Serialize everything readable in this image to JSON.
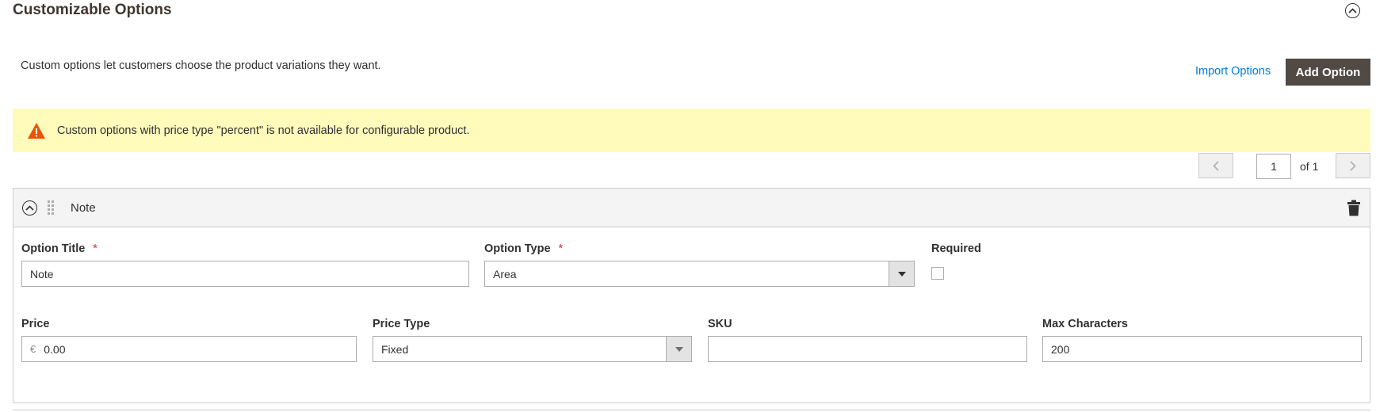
{
  "section": {
    "title": "Customizable Options",
    "intro": "Custom options let customers choose the product variations they want.",
    "import_label": "Import Options",
    "add_label": "Add Option"
  },
  "notice": {
    "text": "Custom options with price type \"percent\" is not available for configurable product.",
    "icon": "warning-icon",
    "color": "#fffbbb"
  },
  "pager": {
    "current": "1",
    "of_label": "of 1"
  },
  "option": {
    "name": "Note",
    "title_label": "Option Title",
    "title_value": "Note",
    "type_label": "Option Type",
    "type_value": "Area",
    "required_label": "Required",
    "required_checked": false,
    "price_label": "Price",
    "currency": "€",
    "price_value": "0.00",
    "price_type_label": "Price Type",
    "price_type_value": "Fixed",
    "sku_label": "SKU",
    "sku_value": "",
    "max_chars_label": "Max Characters",
    "max_chars_value": "200",
    "required_star": "*"
  },
  "colors": {
    "primary_button": "#514943",
    "link": "#007bdb",
    "required": "#e22626",
    "warning_icon": "#eb5202"
  }
}
